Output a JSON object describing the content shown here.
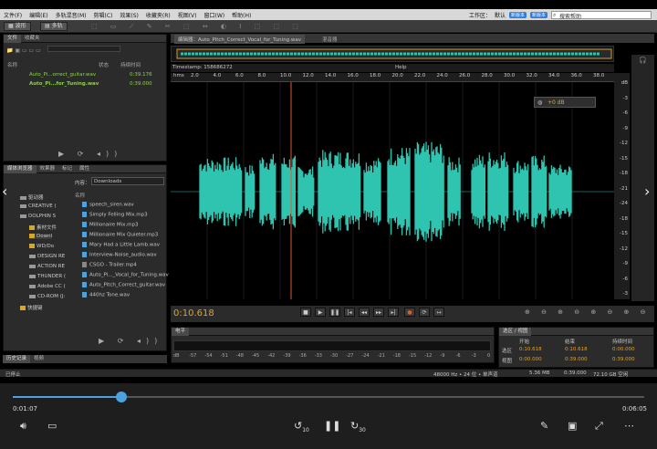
{
  "window": {
    "title": "文件"
  },
  "menu": [
    "文件(F)",
    "编辑(E)",
    "多轨混音(M)",
    "剪辑(C)",
    "效果(S)",
    "收藏夹(R)",
    "视图(V)",
    "窗口(W)",
    "帮助(H)"
  ],
  "menu_right": {
    "workspace_label": "工作区：",
    "workspace_value": "默认",
    "badge1": "新版本",
    "badge2": "新版本",
    "search_placeholder": "搜索帮助"
  },
  "toolbar": {
    "waveform_label": "波形",
    "multitrack_label": "多轨"
  },
  "files_panel": {
    "tabs": [
      "文件",
      "收藏夹"
    ],
    "col_name": "名称",
    "col_status": "状态",
    "col_duration": "持续时间",
    "files": [
      {
        "name": "Auto_Pi...orrect_guitar.wav",
        "duration": "0:39.176"
      },
      {
        "name": "Auto_Pi...for_Tuning.wav",
        "duration": "0:39.000"
      }
    ]
  },
  "media_panel": {
    "tabs": [
      "媒体浏览器",
      "效果器",
      "标记",
      "属性"
    ],
    "content_label": "内容：",
    "content_value": "Downloads",
    "col_name": "名称",
    "tree": [
      "驱动器",
      "CREATIVE (",
      "DOLPHIN S",
      "素材文件",
      "Downl",
      "WD/Do",
      "DESIGN RE",
      "ACTION RE",
      "THUNDER (",
      "Adobe CC (",
      "CD-ROM (J:",
      "快捷键"
    ],
    "files": [
      "speech_siren.wav",
      "Simply Felling Mix.mp3",
      "Millionaire Mix.mp3",
      "Millionaire Mix Quieter.mp3",
      "Mary Had a Little Lamb.wav",
      "Interview-Noise_audio.wav",
      "CSGO - Trailer.mp4",
      "Auto_Pi..._Vocal_for_Tuning.wav",
      "Auto_Pitch_Correct_guitar.wav",
      "440hz Tone.wav"
    ]
  },
  "editor": {
    "tab_label": "编辑器：Auto_Pitch_Correct_Vocal_for_Tuning.wav",
    "tab2": "混音器",
    "timestamp": "Timestamp: 158686272",
    "help_marker": "Help",
    "hms": "hms",
    "time_display": "0:10.618",
    "gain": "+0 dB",
    "ruler": [
      "2.0",
      "4.0",
      "6.0",
      "8.0",
      "10.0",
      "12.0",
      "14.0",
      "16.0",
      "18.0",
      "20.0",
      "22.0",
      "24.0",
      "26.0",
      "28.0",
      "30.0",
      "32.0",
      "34.0",
      "36.0",
      "38.0"
    ],
    "db_scale": [
      "dB",
      "-3",
      "-6",
      "-9",
      "-12",
      "-15",
      "-18",
      "-21",
      "-24",
      "-18",
      "-15",
      "-12",
      "-9",
      "-6",
      "-3"
    ]
  },
  "levels": {
    "title": "电平",
    "ticks": [
      "dB",
      "-57",
      "-54",
      "-51",
      "-48",
      "-45",
      "-42",
      "-39",
      "-36",
      "-33",
      "-30",
      "-27",
      "-24",
      "-21",
      "-18",
      "-15",
      "-12",
      "-9",
      "-6",
      "-3",
      "0"
    ]
  },
  "selection": {
    "title": "选区 / 视图",
    "col_start": "开始",
    "col_end": "结束",
    "col_duration": "持续时间",
    "sel_label": "选区",
    "view_label": "视图",
    "sel_start": "0:10.618",
    "sel_end": "0:10.618",
    "sel_dur": "0:00.000",
    "view_start": "0:00.000",
    "view_end": "0:39.000",
    "view_dur": "0:39.000"
  },
  "history": {
    "tabs": [
      "历史记录",
      "视频"
    ],
    "status": "已停止"
  },
  "statusbar": {
    "format": "48000 Hz • 24 位 • 单声道",
    "size": "5.36 MB",
    "duration": "0:39.000",
    "free": "72.10 GB 空闲"
  },
  "player": {
    "current": "0:01:07",
    "total": "0:06:05",
    "progress": 0.172,
    "skip_back": "10",
    "skip_fwd": "30"
  },
  "colors": {
    "wave": "#2ec4b0",
    "playhead": "#e05a2a",
    "accent": "#e8a21c"
  }
}
